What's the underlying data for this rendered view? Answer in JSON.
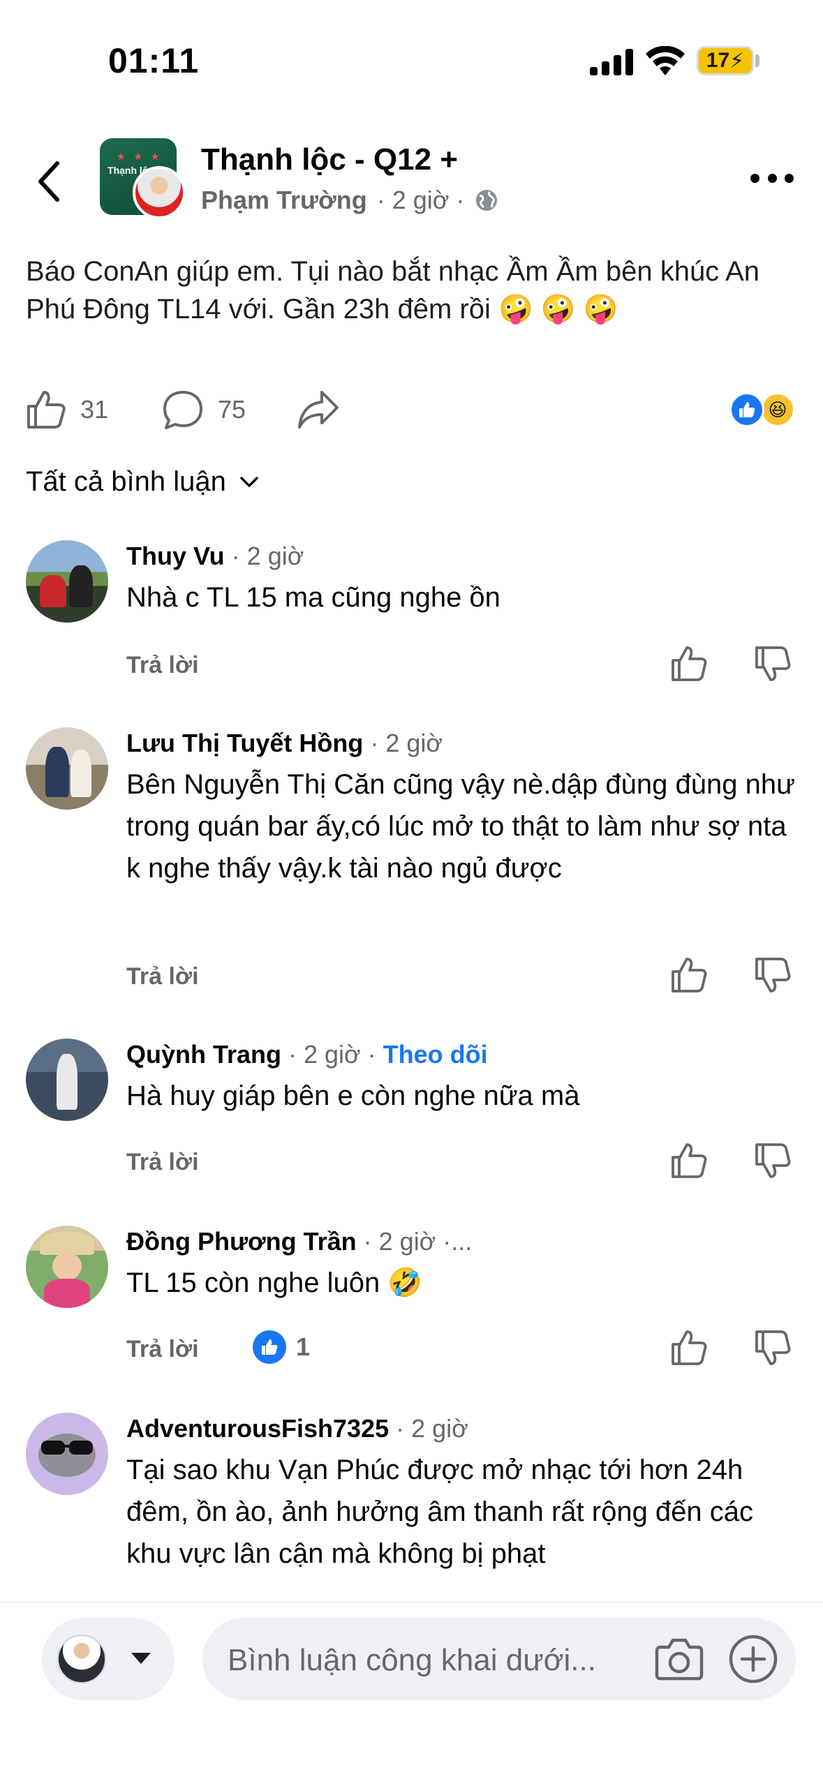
{
  "status_bar": {
    "time": "01:11",
    "battery": "17"
  },
  "header": {
    "group_name": "Thạnh lộc - Q12 +",
    "group_avatar_text": "Thạnh lộc TP",
    "author": "Phạm Trường",
    "time": "· 2 giờ ·"
  },
  "post": {
    "text": "Báo ConAn giúp em. Tụi nào bắt nhạc Ầm Ầm bên khúc An Phú Đông TL14 với. Gần 23h đêm rồi 🤪 🤪 🤪",
    "likes": "31",
    "comments": "75"
  },
  "filter": {
    "label": "Tất cả bình luận"
  },
  "comments": [
    {
      "name": "Thuy Vu",
      "time": " · 2 giờ",
      "text": "Nhà c TL 15 ma cũng nghe ồn",
      "reply": "Trả lời"
    },
    {
      "name": "Lưu Thị Tuyết Hồng",
      "time": " · 2 giờ",
      "text": "Bên Nguyễn Thị Căn cũng vậy nè.dập đùng đùng như trong quán bar ấy,có lúc mở to thật to làm như sợ nta k nghe thấy vậy.k tài nào ngủ được",
      "reply": "Trả lời"
    },
    {
      "name": "Quỳnh Trang",
      "time": " · 2 giờ · ",
      "follow": "Theo dõi",
      "text": "Hà huy giáp bên e còn nghe nữa mà",
      "reply": "Trả lời"
    },
    {
      "name": "Đồng Phương Trần",
      "time": " · 2 giờ ·...",
      "text": "TL 15 còn nghe luôn 🤣",
      "reply": "Trả lời",
      "reaction_count": "1"
    },
    {
      "name": "AdventurousFish7325",
      "time": " · 2 giờ",
      "text": "Tại sao khu Vạn Phúc được mở nhạc tới hơn 24h đêm, ồn ào, ảnh hưởng âm thanh rất rộng đến các khu vực lân cận mà không bị phạt"
    }
  ],
  "composer": {
    "placeholder": "Bình luận công khai dưới..."
  },
  "colors": {
    "accent": "#1877f2",
    "secondary_text": "#65676b",
    "primary_text": "#050505"
  }
}
